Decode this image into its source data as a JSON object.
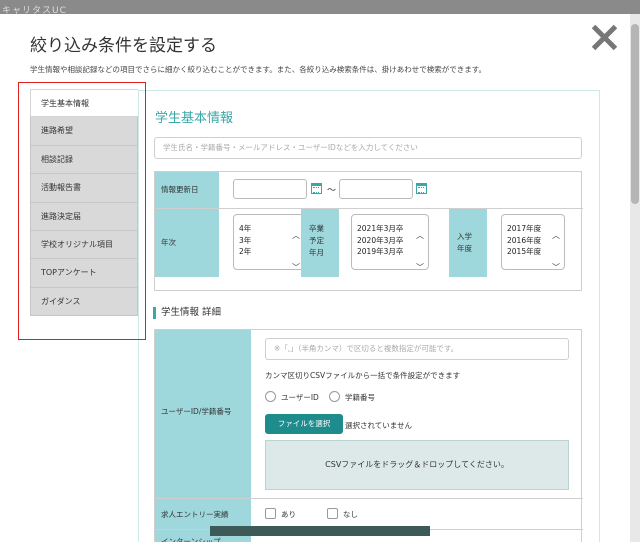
{
  "backdrop": {
    "logo": "キャリタスUC"
  },
  "modal": {
    "title": "絞り込み条件を設定する",
    "description": "学生情報や相談記録などの項目でさらに細かく絞り込むことができます。また、各絞り込み検索条件は、掛けあわせで検索ができます。"
  },
  "sidebar": {
    "items": [
      {
        "label": "学生基本情報",
        "active": true
      },
      {
        "label": "進路希望"
      },
      {
        "label": "相談記録"
      },
      {
        "label": "活動報告書"
      },
      {
        "label": "進路決定届"
      },
      {
        "label": "学校オリジナル項目"
      },
      {
        "label": "TOPアンケート"
      },
      {
        "label": "ガイダンス"
      }
    ]
  },
  "basic": {
    "title": "学生基本情報",
    "search_placeholder": "学生氏名・学籍番号・メールアドレス・ユーザーIDなどを入力してください",
    "info_update_label": "情報更新日",
    "tilde": "～",
    "year_label": "年次",
    "year_options": [
      "4年",
      "3年",
      "2年"
    ],
    "grad_label": "卒業予定年月",
    "grad_label_lines": [
      "卒業",
      "予定",
      "年月"
    ],
    "grad_options": [
      "2021年3月卒",
      "2020年3月卒",
      "2019年3月卒"
    ],
    "entry_label_lines": [
      "入学",
      "年度"
    ],
    "entry_options": [
      "2017年度",
      "2016年度",
      "2015年度"
    ]
  },
  "detail": {
    "title": "学生情報 詳細",
    "userid_label": "ユーザーID/学籍番号",
    "csv_placeholder": "※「,」（半角カンマ）で区切ると複数指定が可能です。",
    "csv_note": "カンマ区切りCSVファイルから一括で条件設定ができます",
    "radio_options": [
      "ユーザーID",
      "学籍番号"
    ],
    "file_button": "ファイルを選択",
    "file_status": "選択されていません",
    "dropzone_text": "CSVファイルをドラッグ＆ドロップしてください。",
    "entry_label": "求人エントリー実績",
    "entry_options": [
      "あり",
      "なし"
    ],
    "intern_label": "インターンシップ"
  },
  "colors": {
    "accent": "#3aa8a8",
    "label_bg": "#9ed8dc",
    "button": "#1e8c8c",
    "highlight": "#e02020"
  }
}
